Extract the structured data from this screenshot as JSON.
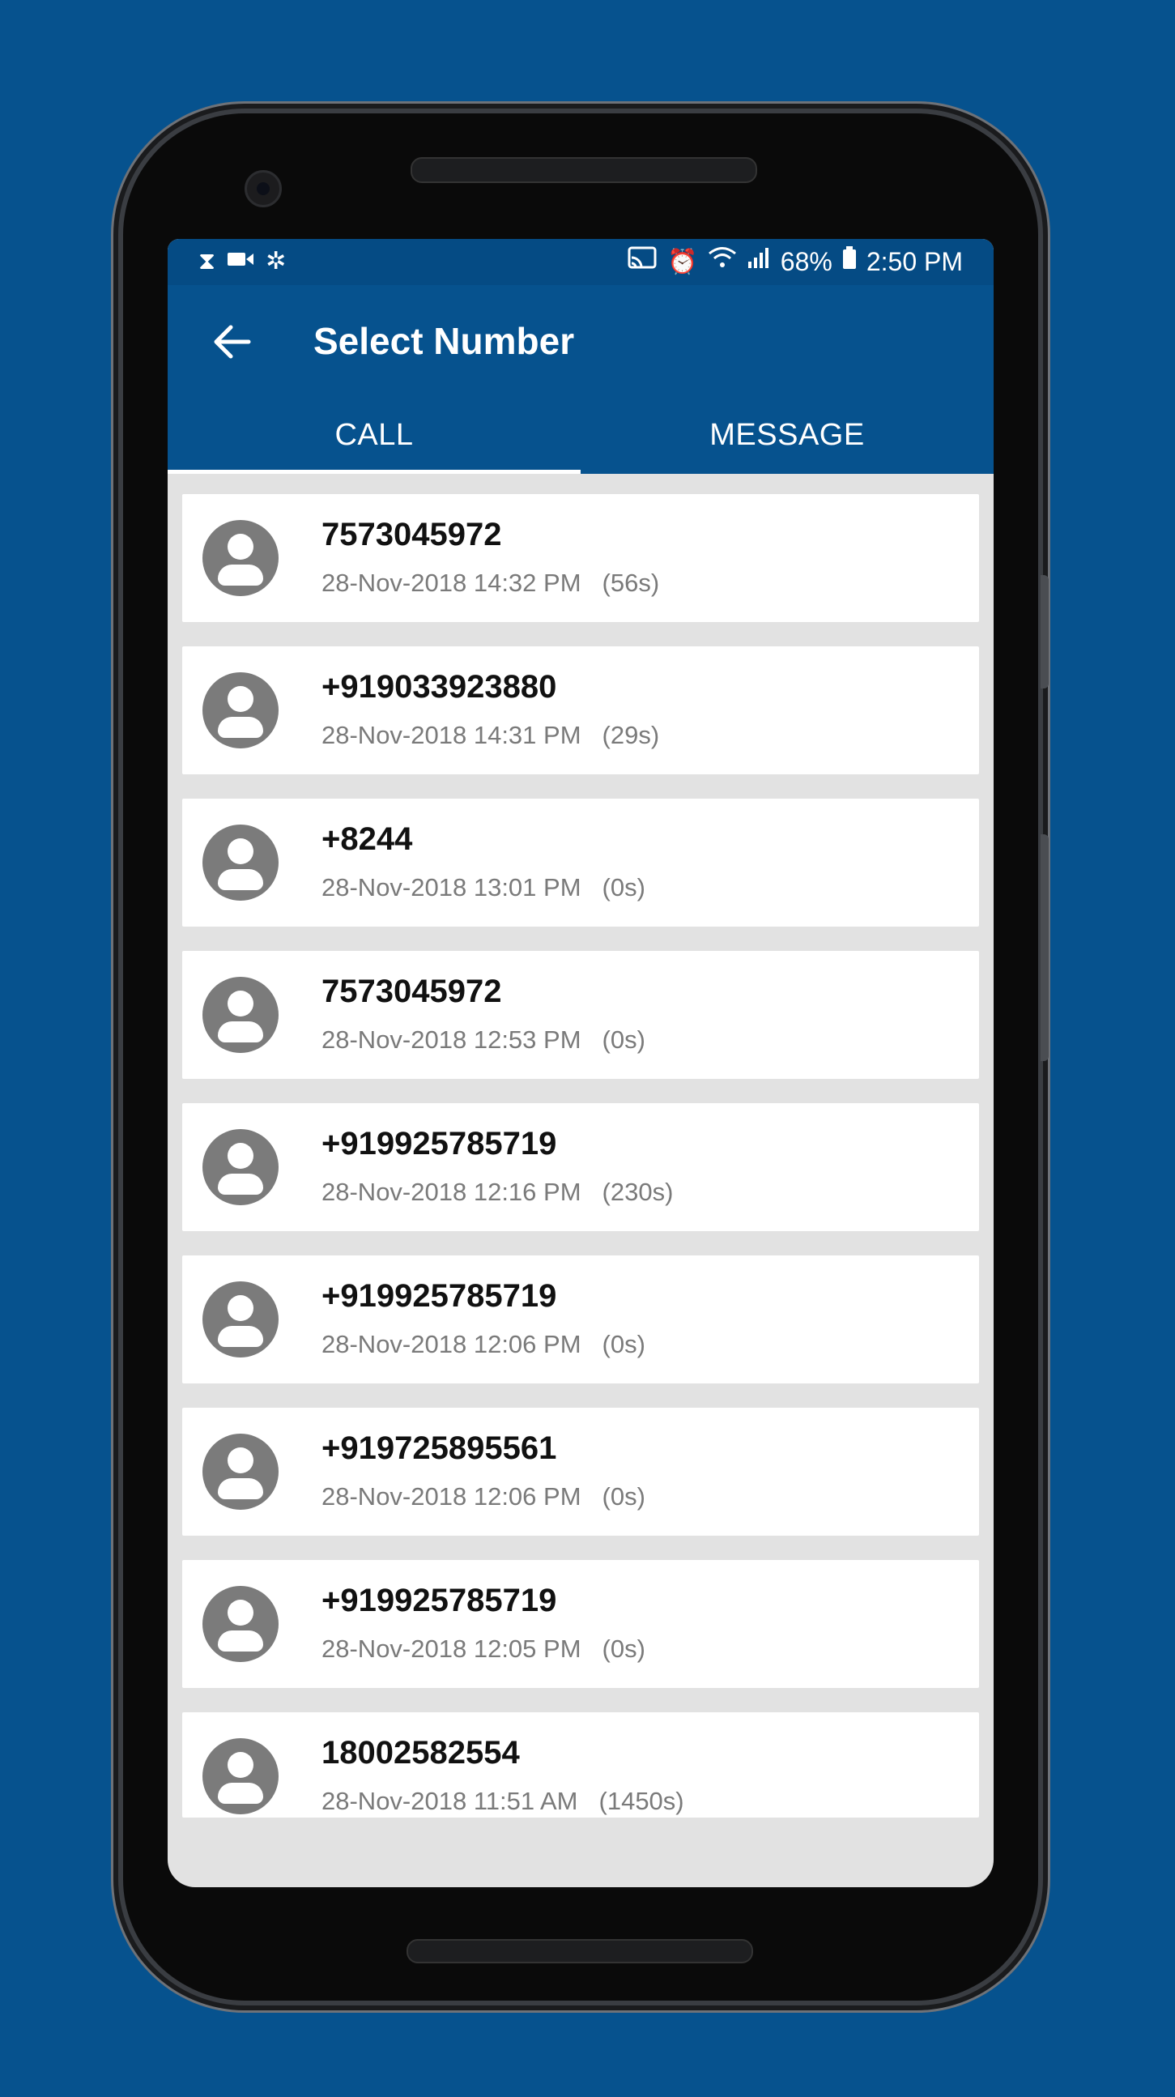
{
  "status_bar": {
    "left_icons": [
      "hourglass-icon",
      "video-camera-icon",
      "fan-icon"
    ],
    "right_icons": [
      "cast-icon",
      "alarm-icon",
      "wifi-icon",
      "signal-icon"
    ],
    "battery": "68%",
    "time": "2:50 PM"
  },
  "app_bar": {
    "title": "Select Number"
  },
  "tabs": [
    {
      "label": "CALL",
      "active": true
    },
    {
      "label": "MESSAGE",
      "active": false
    }
  ],
  "calls": [
    {
      "number": "7573045972",
      "datetime": "28-Nov-2018 14:32 PM",
      "duration": "(56s)"
    },
    {
      "number": "+919033923880",
      "datetime": "28-Nov-2018 14:31 PM",
      "duration": "(29s)"
    },
    {
      "number": "+8244",
      "datetime": "28-Nov-2018 13:01 PM",
      "duration": "(0s)"
    },
    {
      "number": "7573045972",
      "datetime": "28-Nov-2018 12:53 PM",
      "duration": "(0s)"
    },
    {
      "number": "+919925785719",
      "datetime": "28-Nov-2018 12:16 PM",
      "duration": "(230s)"
    },
    {
      "number": "+919925785719",
      "datetime": "28-Nov-2018 12:06 PM",
      "duration": "(0s)"
    },
    {
      "number": "+919725895561",
      "datetime": "28-Nov-2018 12:06 PM",
      "duration": "(0s)"
    },
    {
      "number": "+919925785719",
      "datetime": "28-Nov-2018 12:05 PM",
      "duration": "(0s)"
    },
    {
      "number": "18002582554",
      "datetime": "28-Nov-2018 11:51 AM",
      "duration": "(1450s)"
    }
  ],
  "colors": {
    "primary": "#06528e",
    "status_bar": "#054b84",
    "list_bg": "#e2e2e2",
    "avatar": "#7b7b7b"
  }
}
